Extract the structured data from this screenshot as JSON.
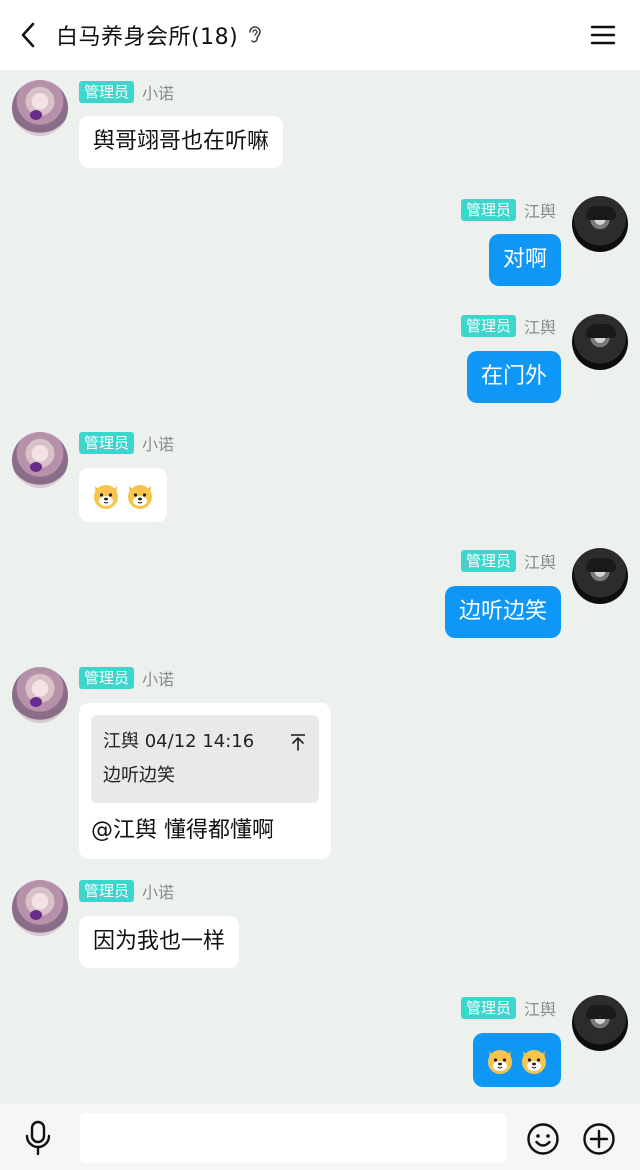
{
  "header": {
    "title": "白马养身会所(18)",
    "back_icon": "chevron-left-icon",
    "listen_icon": "ear-icon",
    "menu_icon": "hamburger-menu-icon"
  },
  "badge_label": "管理员",
  "messages": [
    {
      "side": "in",
      "nick": "小诺",
      "text": "舆哥翊哥也在听嘛"
    },
    {
      "side": "out",
      "nick": "江舆",
      "text": "对啊"
    },
    {
      "side": "out",
      "nick": "江舆",
      "text": "在门外"
    },
    {
      "side": "in",
      "nick": "小诺",
      "emoji": [
        "dog-emoji",
        "dog-emoji"
      ]
    },
    {
      "side": "out",
      "nick": "江舆",
      "text": "边听边笑"
    },
    {
      "side": "in",
      "nick": "小诺",
      "quote": {
        "author_time": "江舆 04/12 14:16",
        "text": "边听边笑"
      },
      "text": "@江舆 懂得都懂啊"
    },
    {
      "side": "in",
      "nick": "小诺",
      "text": "因为我也一样"
    },
    {
      "side": "out",
      "nick": "江舆",
      "emoji": [
        "dog-emoji",
        "dog-emoji"
      ]
    }
  ],
  "input": {
    "placeholder": ""
  },
  "colors": {
    "outgoing_bubble": "#0f97f8",
    "badge": "#3ed6cc",
    "background": "#edf1ee"
  }
}
